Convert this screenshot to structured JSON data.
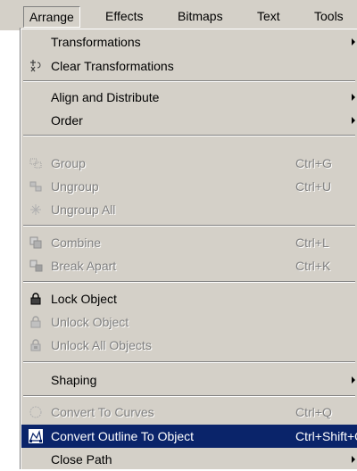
{
  "menubar": {
    "items": [
      {
        "label": "Arrange",
        "active": true
      },
      {
        "label": "Effects"
      },
      {
        "label": "Bitmaps"
      },
      {
        "label": "Text"
      },
      {
        "label": "Tools"
      }
    ]
  },
  "menu": {
    "items": [
      {
        "label": "Transformations",
        "submenu": true
      },
      {
        "label": "Clear Transformations",
        "icon": "clear-transform-icon"
      },
      {
        "label": "Align and Distribute",
        "submenu": true
      },
      {
        "label": "Order",
        "submenu": true
      },
      {
        "label": "Group",
        "shortcut": "Ctrl+G",
        "disabled": true,
        "icon": "group-icon"
      },
      {
        "label": "Ungroup",
        "shortcut": "Ctrl+U",
        "disabled": true,
        "icon": "ungroup-icon"
      },
      {
        "label": "Ungroup All",
        "disabled": true,
        "icon": "ungroup-all-icon"
      },
      {
        "label": "Combine",
        "shortcut": "Ctrl+L",
        "disabled": true,
        "icon": "combine-icon"
      },
      {
        "label": "Break Apart",
        "shortcut": "Ctrl+K",
        "disabled": true,
        "icon": "break-apart-icon"
      },
      {
        "label": "Lock Object",
        "icon": "lock-icon"
      },
      {
        "label": "Unlock Object",
        "disabled": true,
        "icon": "unlock-icon"
      },
      {
        "label": "Unlock All Objects",
        "disabled": true,
        "icon": "unlock-all-icon"
      },
      {
        "label": "Shaping",
        "submenu": true
      },
      {
        "label": "Convert To Curves",
        "shortcut": "Ctrl+Q",
        "disabled": true,
        "icon": "convert-to-curves-icon"
      },
      {
        "label": "Convert Outline To Object",
        "shortcut": "Ctrl+Shift+Q",
        "highlighted": true,
        "icon": "convert-outline-icon"
      },
      {
        "label": "Close Path",
        "submenu": true
      }
    ]
  },
  "colors": {
    "menu_bg": "#d4d0c8",
    "highlight_bg": "#0a246a",
    "disabled_text": "#808080"
  }
}
